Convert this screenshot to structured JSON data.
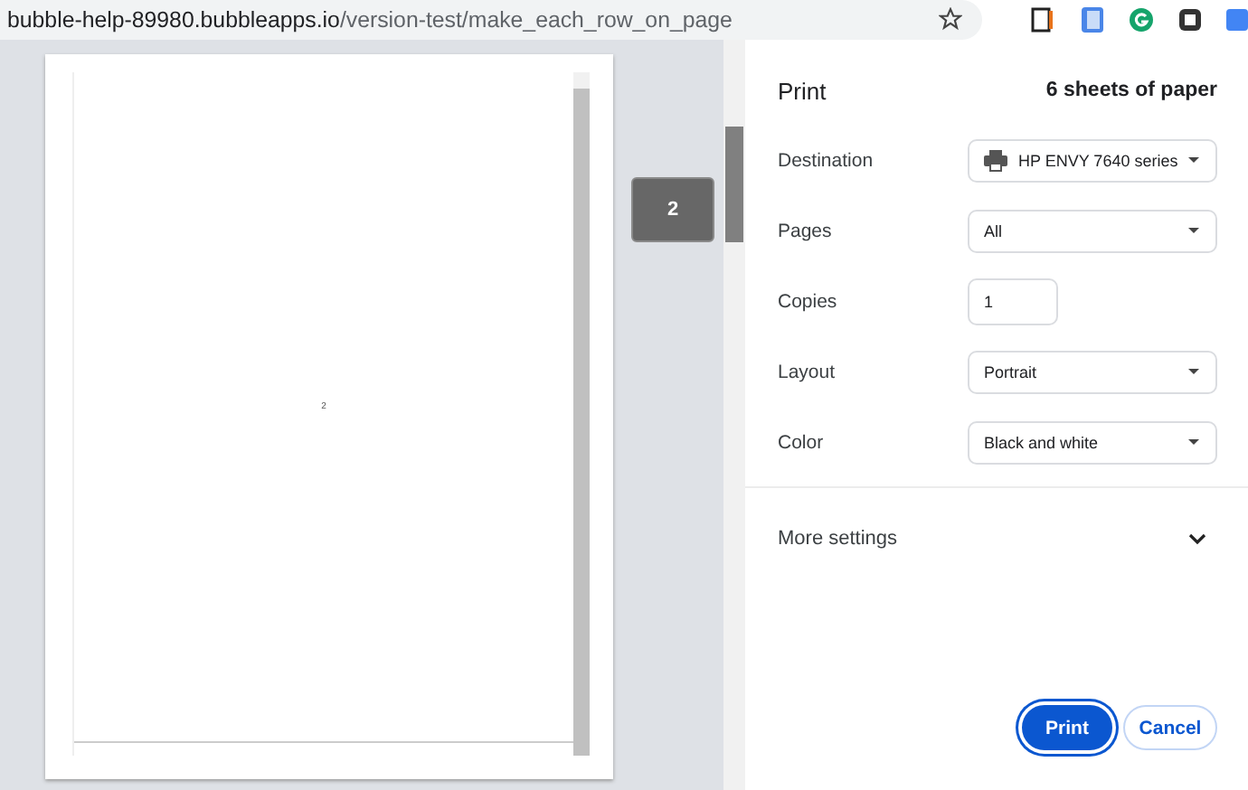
{
  "address_bar": {
    "host": "bubble-help-89980.bubbleapps.io",
    "path": "/version-test/make_each_row_on_page"
  },
  "preview": {
    "page_number": "2",
    "page_tooltip": "2"
  },
  "print_panel": {
    "title": "Print",
    "sheets": "6 sheets of paper",
    "settings": [
      {
        "label": "Destination",
        "kind": "printer",
        "value": "HP ENVY 7640 series"
      },
      {
        "label": "Pages",
        "kind": "dropdown",
        "value": "All"
      },
      {
        "label": "Copies",
        "kind": "number",
        "value": "1"
      },
      {
        "label": "Layout",
        "kind": "dropdown",
        "value": "Portrait"
      },
      {
        "label": "Color",
        "kind": "dropdown",
        "value": "Black and white"
      }
    ],
    "more_settings": {
      "label": "More settings",
      "expanded": false
    },
    "buttons": [
      {
        "label": "Print",
        "kind": "primary"
      },
      {
        "label": "Cancel",
        "kind": "secondary"
      }
    ]
  }
}
